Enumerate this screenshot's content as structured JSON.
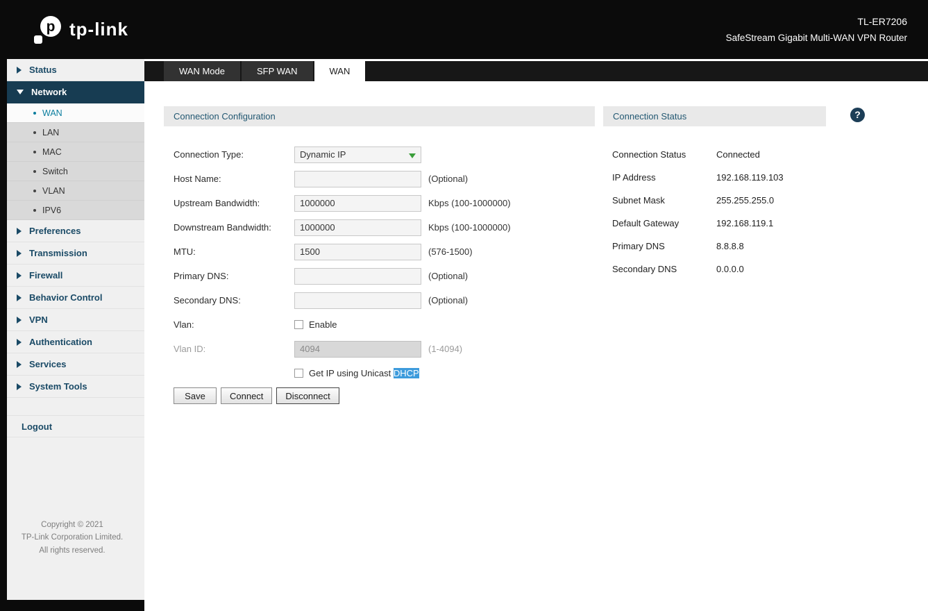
{
  "header": {
    "model": "TL-ER7206",
    "subtitle": "SafeStream Gigabit Multi-WAN VPN Router",
    "logo_text": "tp-link"
  },
  "sidebar": {
    "items": [
      {
        "label": "Status"
      },
      {
        "label": "Network",
        "children": [
          "WAN",
          "LAN",
          "MAC",
          "Switch",
          "VLAN",
          "IPV6"
        ],
        "active_child": "WAN"
      },
      {
        "label": "Preferences"
      },
      {
        "label": "Transmission"
      },
      {
        "label": "Firewall"
      },
      {
        "label": "Behavior Control"
      },
      {
        "label": "VPN"
      },
      {
        "label": "Authentication"
      },
      {
        "label": "Services"
      },
      {
        "label": "System Tools"
      }
    ],
    "logout_label": "Logout",
    "copyright": [
      "Copyright © 2021",
      "TP-Link Corporation Limited.",
      "All rights reserved."
    ]
  },
  "tabs": [
    {
      "label": "WAN Mode",
      "active": false
    },
    {
      "label": "SFP WAN",
      "active": false
    },
    {
      "label": "WAN",
      "active": true
    }
  ],
  "form": {
    "section_title": "Connection Configuration",
    "connection_type": {
      "label": "Connection Type:",
      "value": "Dynamic IP"
    },
    "host_name": {
      "label": "Host Name:",
      "value": "",
      "hint": "(Optional)"
    },
    "upstream": {
      "label": "Upstream Bandwidth:",
      "value": "1000000",
      "hint": "Kbps (100-1000000)"
    },
    "downstream": {
      "label": "Downstream Bandwidth:",
      "value": "1000000",
      "hint": "Kbps (100-1000000)"
    },
    "mtu": {
      "label": "MTU:",
      "value": "1500",
      "hint": "(576-1500)"
    },
    "primary_dns": {
      "label": "Primary DNS:",
      "value": "",
      "hint": "(Optional)"
    },
    "secondary_dns": {
      "label": "Secondary DNS:",
      "value": "",
      "hint": "(Optional)"
    },
    "vlan": {
      "label": "Vlan:",
      "checkbox_label": "Enable",
      "checked": false
    },
    "vlan_id": {
      "label": "Vlan ID:",
      "value": "4094",
      "hint": "(1-4094)",
      "disabled": true
    },
    "unicast": {
      "label_prefix": "Get IP using Unicast ",
      "label_highlight": "DHCP",
      "checked": false
    },
    "buttons": {
      "save": "Save",
      "connect": "Connect",
      "disconnect": "Disconnect"
    }
  },
  "status": {
    "section_title": "Connection Status",
    "rows": [
      {
        "label": "Connection Status",
        "value": "Connected"
      },
      {
        "label": "IP Address",
        "value": "192.168.119.103"
      },
      {
        "label": "Subnet Mask",
        "value": "255.255.255.0"
      },
      {
        "label": "Default Gateway",
        "value": "192.168.119.1"
      },
      {
        "label": "Primary DNS",
        "value": "8.8.8.8"
      },
      {
        "label": "Secondary DNS",
        "value": "0.0.0.0"
      }
    ]
  },
  "icons": {
    "help": "?"
  },
  "colors": {
    "header_bg": "#0b0b0b",
    "active_nav_bg": "#173c52",
    "nav_text": "#1a4a66",
    "active_sub_text": "#0a7d9e",
    "panel_header_bg": "#e9e9e9",
    "panel_title": "#235872",
    "dropdown_arrow": "#3a9e3a",
    "selection_highlight": "#3d9bdc",
    "help_icon_bg": "#1c3e57"
  }
}
